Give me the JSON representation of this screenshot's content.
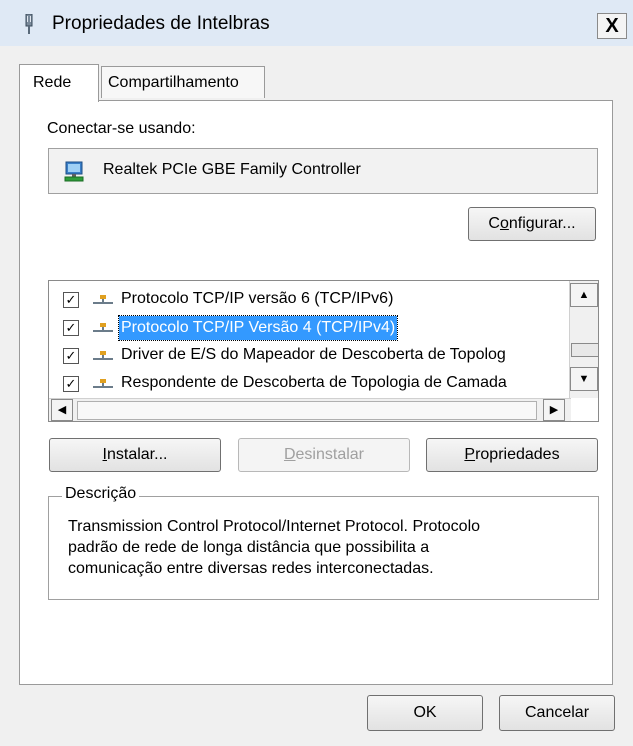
{
  "window": {
    "title": "Propriedades de Intelbras",
    "close_symbol": "X"
  },
  "tabs": [
    {
      "label": "Rede",
      "active": true
    },
    {
      "label": "Compartilhamento",
      "active": false
    }
  ],
  "connection": {
    "label": "Conectar-se usando:",
    "adapter_name": "Realtek PCIe GBE Family Controller",
    "configure_button": {
      "pre": "C",
      "ul": "o",
      "post": "nfigurar..."
    }
  },
  "components": {
    "items": [
      {
        "label": "Protocolo TCP/IP versão 6 (TCP/IPv6)",
        "checked": true,
        "selected": false
      },
      {
        "label": "Protocolo TCP/IP Versão 4 (TCP/IPv4)",
        "checked": true,
        "selected": true
      },
      {
        "label": "Driver de E/S do Mapeador de Descoberta de Topolog",
        "checked": true,
        "selected": false
      },
      {
        "label": "Respondente de Descoberta de Topologia de Camada",
        "checked": true,
        "selected": false
      }
    ],
    "check_symbol": "✓"
  },
  "actions": {
    "install": {
      "ul": "I",
      "post": "nstalar..."
    },
    "uninstall": {
      "ul": "D",
      "post": "esinstalar",
      "enabled": false
    },
    "properties": {
      "ul": "P",
      "post": "ropriedades"
    }
  },
  "description": {
    "legend": "Descrição",
    "lines": [
      "Transmission Control Protocol/Internet Protocol. Protocolo",
      "padrão de rede de longa distância que possibilita a",
      "comunicação entre diversas redes interconectadas."
    ]
  },
  "footer": {
    "ok_label": "OK",
    "cancel_label": "Cancelar"
  },
  "colors": {
    "selection": "#3399ff",
    "titlebar": "#dfe9f5"
  }
}
